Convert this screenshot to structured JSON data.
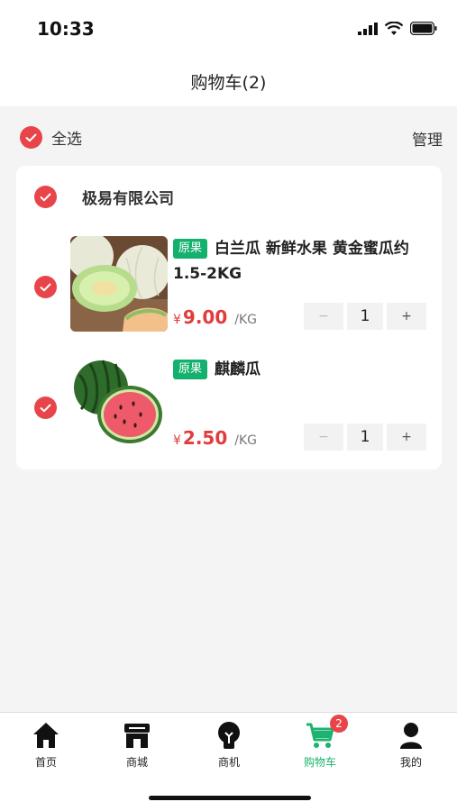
{
  "status_bar": {
    "time": "10:33"
  },
  "header": {
    "title": "购物车(2)"
  },
  "select_bar": {
    "select_all_label": "全选",
    "manage_label": "管理"
  },
  "shop": {
    "name": "极易有限公司"
  },
  "items": [
    {
      "tag": "原果",
      "name": "白兰瓜 新鲜水果 黄金蜜瓜约1.5-2KG",
      "currency": "¥",
      "price": "9.00",
      "unit": "/KG",
      "quantity": "1",
      "minus": "−",
      "plus": "+"
    },
    {
      "tag": "原果",
      "name": "麒麟瓜",
      "currency": "¥",
      "price": "2.50",
      "unit": "/KG",
      "quantity": "1",
      "minus": "−",
      "plus": "+"
    }
  ],
  "tab_bar": {
    "tabs": [
      {
        "label": "首页",
        "icon": "home-icon"
      },
      {
        "label": "商城",
        "icon": "store-icon"
      },
      {
        "label": "商机",
        "icon": "lightbulb-icon"
      },
      {
        "label": "购物车",
        "icon": "cart-icon",
        "badge": "2",
        "active": true
      },
      {
        "label": "我的",
        "icon": "user-icon"
      }
    ]
  },
  "colors": {
    "accent_red": "#e8454a",
    "price_red": "#e23b3b",
    "tag_green": "#14b06e",
    "active_green": "#1bb36f"
  }
}
